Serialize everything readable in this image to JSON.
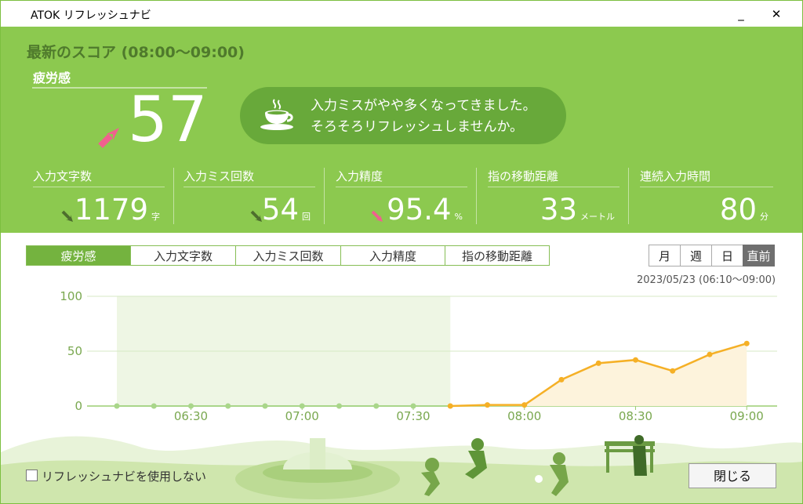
{
  "window": {
    "title": "ATOK リフレッシュナビ",
    "minimize_label": "_",
    "close_label": "✕"
  },
  "score": {
    "title": "最新のスコア (08:00～09:00)",
    "fatigue_label": "疲労感",
    "fatigue_value": "57",
    "fatigue_trend": "up",
    "message_line1": "入力ミスがやや多くなってきました。",
    "message_line2": "そろそろリフレッシュしませんか。",
    "message_icon": "coffee-cup-icon"
  },
  "stats": [
    {
      "label": "入力文字数",
      "value": "1179",
      "unit": "字",
      "trend": "down"
    },
    {
      "label": "入力ミス回数",
      "value": "54",
      "unit": "回",
      "trend": "down"
    },
    {
      "label": "入力精度",
      "value": "95.4",
      "unit": "%",
      "trend": "down-pink"
    },
    {
      "label": "指の移動距離",
      "value": "33",
      "unit": "メートル",
      "trend": "none"
    },
    {
      "label": "連続入力時間",
      "value": "80",
      "unit": "分",
      "trend": "none"
    }
  ],
  "tabs": [
    "疲労感",
    "入力文字数",
    "入力ミス回数",
    "入力精度",
    "指の移動距離"
  ],
  "active_tab": 0,
  "period": [
    "月",
    "週",
    "日",
    "直前"
  ],
  "active_period": 3,
  "date_range": "2023/05/23 (06:10～09:00)",
  "footer": {
    "checkbox_label": "リフレッシュナビを使用しない",
    "close_button": "閉じる"
  },
  "colors": {
    "header_green": "#8cc94f",
    "bubble_green": "#68a93a",
    "series_orange": "#f5b026",
    "series_green": "#a9d68a",
    "arrow_pink": "#f0608f",
    "arrow_dark": "#4e6e2e"
  },
  "chart_data": {
    "type": "line",
    "x": [
      "06:10",
      "06:20",
      "06:30",
      "06:40",
      "06:50",
      "07:00",
      "07:10",
      "07:20",
      "07:30",
      "07:40",
      "07:50",
      "08:00",
      "08:10",
      "08:20",
      "08:30",
      "08:40",
      "08:50",
      "09:00"
    ],
    "values": [
      0,
      0,
      0,
      0,
      0,
      0,
      0,
      0,
      0,
      0,
      1,
      1,
      24,
      39,
      42,
      32,
      47,
      57
    ],
    "highlight_range": [
      "06:10",
      "07:40"
    ],
    "x_ticks": [
      "06:30",
      "07:00",
      "07:30",
      "08:00",
      "08:30",
      "09:00"
    ],
    "y_ticks": [
      0,
      50,
      100
    ],
    "ylim": [
      0,
      100
    ],
    "grid": true
  }
}
